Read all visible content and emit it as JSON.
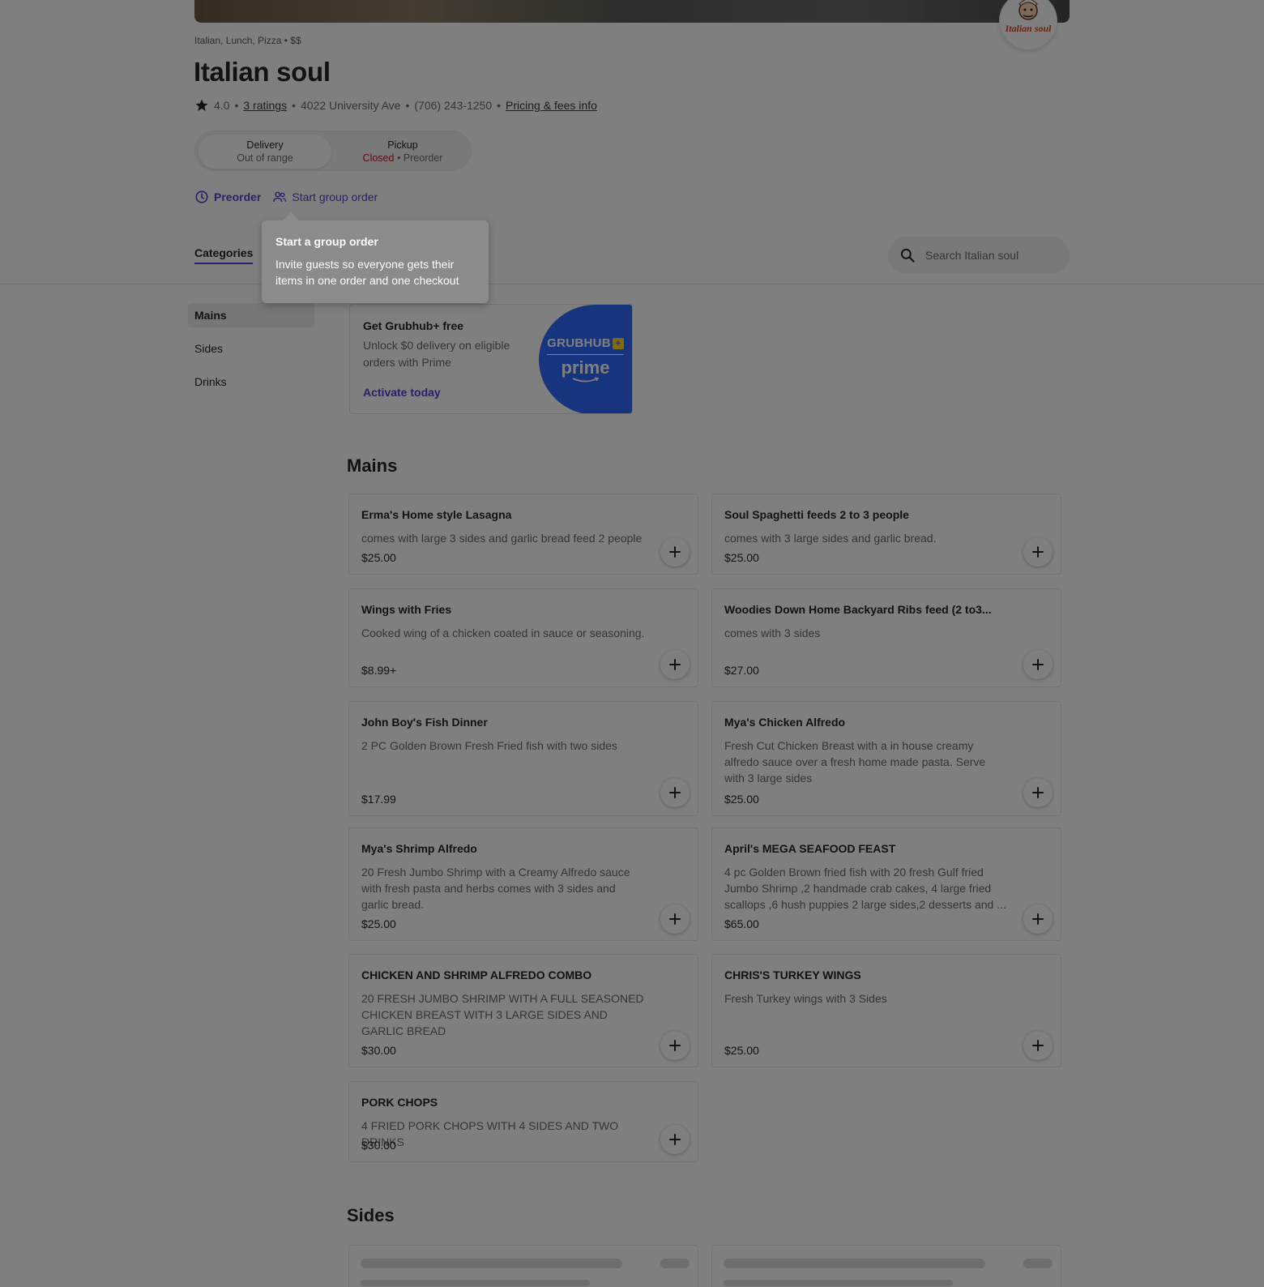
{
  "restaurant": {
    "cuisines": "Italian, Lunch, Pizza",
    "price_tier": "$$",
    "name": "Italian soul",
    "rating": "4.0",
    "ratings_link": "3 ratings",
    "address": "4022 University Ave",
    "phone": "(706) 243-1250",
    "pricing_link": "Pricing & fees info",
    "logo_text": "Italian soul"
  },
  "fulfillment": {
    "delivery": {
      "label": "Delivery",
      "status": "Out of range"
    },
    "pickup": {
      "label": "Pickup",
      "status_closed": "Closed",
      "status_extra": "Preorder"
    }
  },
  "actions": {
    "preorder": "Preorder",
    "group_order": "Start group order"
  },
  "tooltip": {
    "title": "Start a group order",
    "body": "Invite guests so everyone gets their items in one order and one checkout"
  },
  "nav": {
    "categories_tab": "Categories"
  },
  "search": {
    "placeholder": "Search Italian soul"
  },
  "sidebar": {
    "items": [
      "Mains",
      "Sides",
      "Drinks"
    ]
  },
  "promo": {
    "title": "Get Grubhub+ free",
    "subtitle": "Unlock $0 delivery on eligible orders with Prime",
    "cta": "Activate today",
    "brand_top": "GRUBHUB",
    "brand_plus": "+",
    "brand_bottom": "prime"
  },
  "sections": {
    "mains": "Mains",
    "sides": "Sides"
  },
  "menu": [
    {
      "name": "Erma's Home style Lasagna",
      "description": "comes with large 3 sides and garlic bread feed 2 people",
      "price": "$25.00"
    },
    {
      "name": "Soul Spaghetti feeds 2 to 3 people",
      "description": "comes with 3 large sides and garlic bread.",
      "price": "$25.00"
    },
    {
      "name": "Wings with Fries",
      "description": "Cooked wing of a chicken coated in sauce or seasoning.",
      "price": "$8.99+"
    },
    {
      "name": "Woodies Down Home Backyard Ribs feed (2 to3...",
      "description": "comes with 3 sides",
      "price": "$27.00"
    },
    {
      "name": "John Boy's Fish Dinner",
      "description": "2 PC Golden Brown Fresh Fried fish with two sides",
      "price": "$17.99"
    },
    {
      "name": "Mya's Chicken Alfredo",
      "description": "Fresh Cut Chicken Breast with a in house creamy alfredo sauce over a fresh home made pasta. Serve with 3 large sides",
      "price": "$25.00"
    },
    {
      "name": "Mya's Shrimp Alfredo",
      "description": "20 Fresh Jumbo Shrimp with a Creamy Alfredo sauce with fresh pasta and herbs comes with 3 sides and garlic bread.",
      "price": "$25.00"
    },
    {
      "name": "April's MEGA SEAFOOD FEAST",
      "description": "4 pc Golden Brown fried fish with 20 fresh Gulf fried Jumbo Shrimp ,2 handmade crab cakes, 4 large fried scallops ,6 hush puppies 2 large sides,2 desserts and ...",
      "price": "$65.00"
    },
    {
      "name": "CHICKEN AND SHRIMP ALFREDO COMBO",
      "description": "20 FRESH JUMBO SHRIMP WITH A FULL SEASONED CHICKEN BREAST WITH 3 LARGE SIDES AND GARLIC BREAD",
      "price": "$30.00"
    },
    {
      "name": "CHRIS'S TURKEY WINGS",
      "description": "Fresh Turkey wings with 3 Sides",
      "price": "$25.00"
    },
    {
      "name": "PORK CHOPS",
      "description": "4 FRIED PORK CHOPS WITH 4 SIDES AND TWO DRINKS",
      "price": "$30.00"
    }
  ],
  "colors": {
    "accent": "#5a3fd1",
    "closed": "#c8102e",
    "prime_blue": "#2e6bff",
    "overlay": "rgba(0,0,0,0.5)"
  },
  "icons": {
    "rating": "star-icon",
    "preorder": "clock-icon",
    "group": "people-icon",
    "search": "search-icon",
    "add": "plus-icon"
  }
}
